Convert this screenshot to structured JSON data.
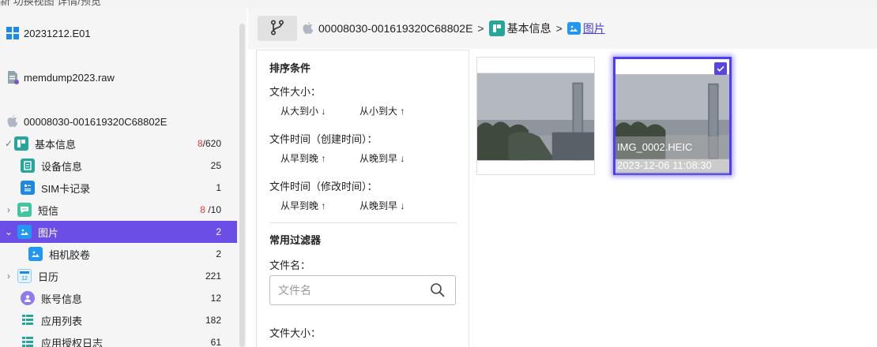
{
  "window": {
    "partial_title": "新    功换视图 详情/预览"
  },
  "sidebar": {
    "cases": [
      {
        "name": "20231212.E01",
        "icon": "windows-icon"
      },
      {
        "name": "memdump2023.raw",
        "icon": "file-icon"
      },
      {
        "name": "00008030-001619320C68802E",
        "icon": "apple-icon"
      }
    ],
    "tree": [
      {
        "label": "基本信息",
        "count_red": "8",
        "count": "/620",
        "icon": "basic-info-icon",
        "expand": "✓"
      },
      {
        "label": "设备信息",
        "count": "25",
        "icon": "device-info-icon"
      },
      {
        "label": "SIM卡记录",
        "count": "1",
        "icon": "sim-icon"
      },
      {
        "label": "短信",
        "count_red": "8",
        "count": " /10",
        "icon": "sms-icon",
        "expand": "›"
      },
      {
        "label": "图片",
        "count": "2",
        "icon": "picture-icon",
        "expand": "⌄",
        "selected": true
      },
      {
        "label": "相机胶卷",
        "count": "2",
        "icon": "camera-roll-icon"
      },
      {
        "label": "日历",
        "count": "221",
        "icon": "calendar-icon",
        "expand": "›"
      },
      {
        "label": "账号信息",
        "count": "12",
        "icon": "account-icon"
      },
      {
        "label": "应用列表",
        "count": "182",
        "icon": "app-list-icon"
      },
      {
        "label": "应用授权日志",
        "count": "61",
        "icon": "app-auth-log-icon"
      }
    ]
  },
  "breadcrumb": {
    "items": [
      "00008030-001619320C68802E",
      "基本信息",
      "图片"
    ],
    "separator": ">"
  },
  "filters": {
    "sort_title": "排序条件",
    "size_label": "文件大小：",
    "size_desc": "从大到小",
    "size_asc": "从小到大",
    "ctime_label": "文件时间（创建时间）：",
    "ctime_asc": "从早到晚",
    "ctime_desc": "从晚到早",
    "mtime_label": "文件时间（修改时间）：",
    "mtime_asc": "从早到晚",
    "mtime_desc": "从晚到早",
    "filter_title": "常用过滤器",
    "name_label": "文件名：",
    "name_placeholder": "文件名",
    "size2_label": "文件大小："
  },
  "gallery": {
    "items": [
      {
        "selected": false,
        "checked": false
      },
      {
        "name": "IMG_0002.HEIC",
        "date": "2023-12-06 11:08:30",
        "selected": true,
        "checked": true
      }
    ]
  },
  "colors": {
    "accent": "#6b4ee6",
    "link": "#4a40d9",
    "count_alert": "#e53935"
  }
}
